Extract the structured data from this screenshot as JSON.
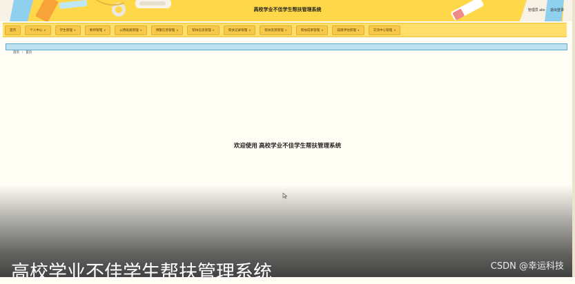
{
  "header": {
    "title": "高校学业不佳学生帮扶管理系统",
    "user_label": "管理员 abo",
    "logout_label": "退出登录"
  },
  "nav": {
    "items": [
      {
        "label": "首页",
        "caret": ""
      },
      {
        "label": "个人中心",
        "caret": "∨"
      },
      {
        "label": "学生管理",
        "caret": "∨"
      },
      {
        "label": "教师管理",
        "caret": "∨"
      },
      {
        "label": "公用班级管理",
        "caret": "∨"
      },
      {
        "label": "预警信息管理",
        "caret": "∨"
      },
      {
        "label": "帮扶信息管理",
        "caret": "∨"
      },
      {
        "label": "帮扶记录管理",
        "caret": "∨"
      },
      {
        "label": "帮扶反馈管理",
        "caret": "∨"
      },
      {
        "label": "帮扶成果管理",
        "caret": "∨"
      },
      {
        "label": "成绩评估管理",
        "caret": "∨"
      },
      {
        "label": "交流中心管理",
        "caret": "∨"
      }
    ]
  },
  "breadcrumb": {
    "home": "首页",
    "sep": "/",
    "current": "首页"
  },
  "main": {
    "welcome": "欢迎使用 高校学业不佳学生帮扶管理系统"
  },
  "overlay": {
    "big_title": "高校学业不佳学生帮扶管理系统",
    "watermark": "CSDN @幸运科技"
  },
  "colors": {
    "header_bg": "#ffd84a",
    "nav_item_bg": "#f7c94a",
    "breadcrumb_bg": "#bfe2f3"
  }
}
